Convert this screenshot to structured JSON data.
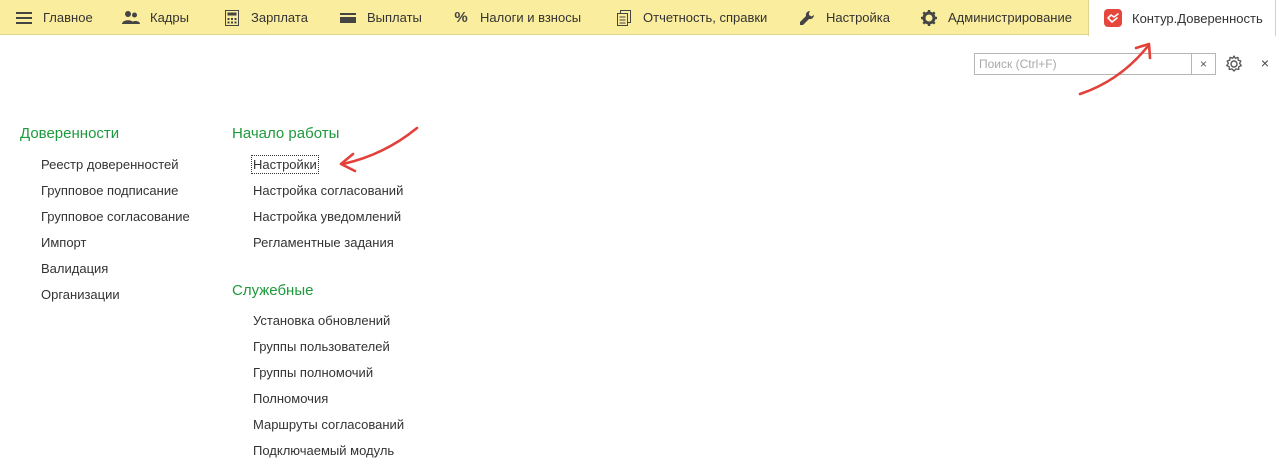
{
  "sections": [
    {
      "label": "Главное",
      "icon": "menu-icon"
    },
    {
      "label": "Кадры",
      "icon": "users-icon"
    },
    {
      "label": "Зарплата",
      "icon": "calculator-icon"
    },
    {
      "label": "Выплаты",
      "icon": "wallet-icon"
    },
    {
      "label": "Налоги и взносы",
      "icon": "percent-icon"
    },
    {
      "label": "Отчетность, справки",
      "icon": "documents-icon"
    },
    {
      "label": "Настройка",
      "icon": "wrench-icon"
    },
    {
      "label": "Администрирование",
      "icon": "gear-icon"
    },
    {
      "label": "Контур.Доверенность",
      "icon": "kontur-logo-icon",
      "active": true
    }
  ],
  "search": {
    "placeholder": "Поиск (Ctrl+F)",
    "value": "",
    "clear_label": "×"
  },
  "window": {
    "close_label": "×"
  },
  "groups": {
    "poa": {
      "title": "Доверенности",
      "items": [
        "Реестр доверенностей",
        "Групповое подписание",
        "Групповое согласование",
        "Импорт",
        "Валидация",
        "Организации"
      ]
    },
    "start": {
      "title": "Начало работы",
      "items": [
        "Настройки",
        "Настройка согласований",
        "Настройка уведомлений",
        "Регламентные задания"
      ]
    },
    "service": {
      "title": "Служебные",
      "items": [
        "Установка обновлений",
        "Группы пользователей",
        "Группы полномочий",
        "Полномочия",
        "Маршруты согласований",
        "Подключаемый модуль"
      ]
    }
  },
  "colors": {
    "topbar": "#fbed9e",
    "group_title": "#1e9a3c",
    "annotation_arrow": "#e2413a",
    "kontur_red": "#e5473d"
  }
}
